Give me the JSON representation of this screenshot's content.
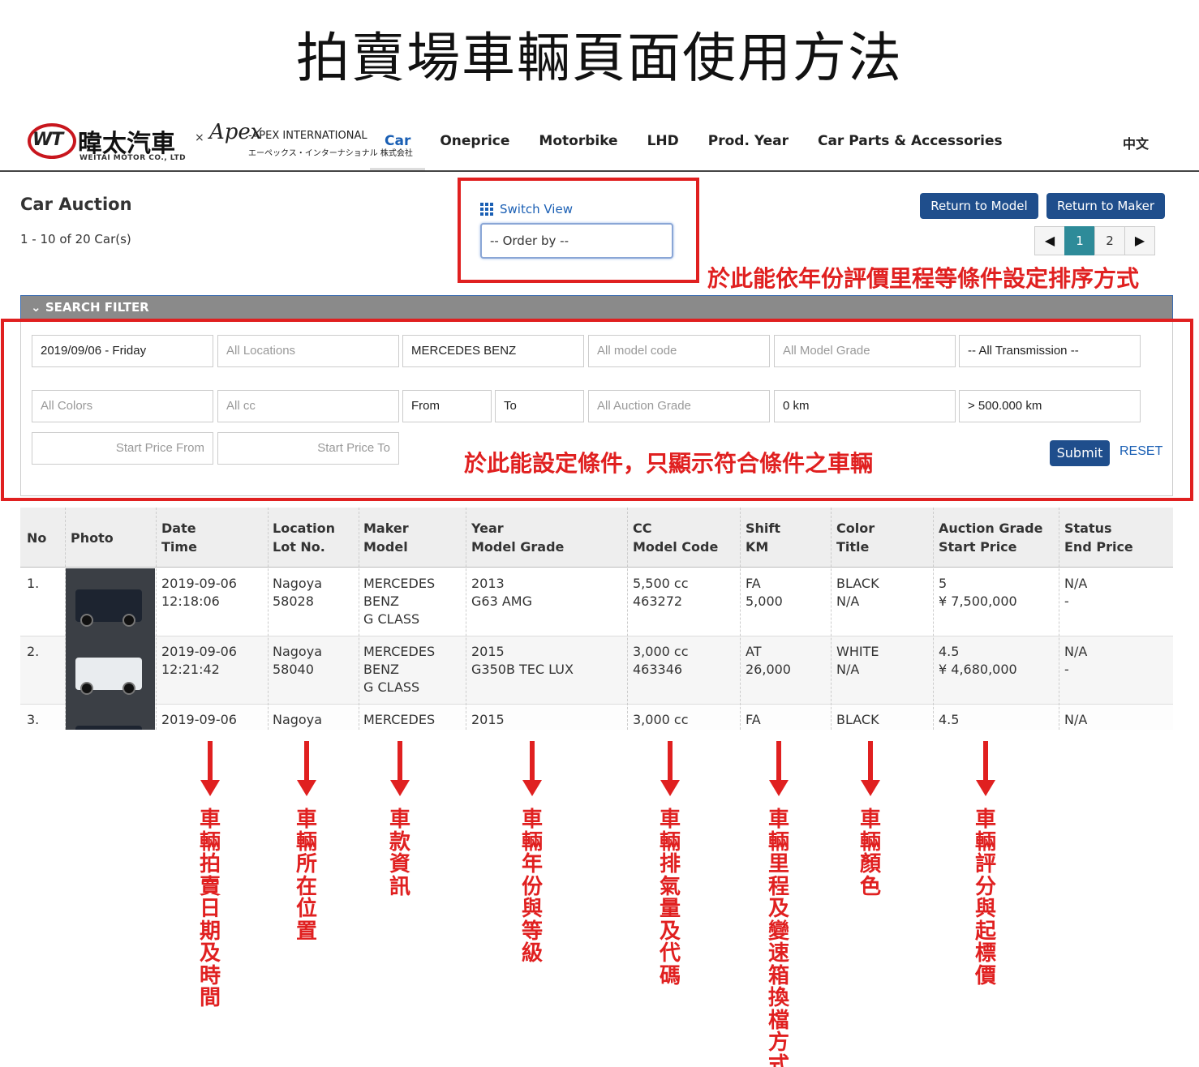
{
  "title": "拍賣場車輛頁面使用方法",
  "header": {
    "logo_wt_mark": "WT",
    "logo_wt_cn": "暐太汽車",
    "logo_wt_en": "WEITAI MOTOR CO., LTD",
    "logo_x": "×",
    "logo_apex_script": "Apex",
    "logo_apex_line1": "-APEX INTERNATIONAL",
    "logo_apex_line2": "エーペックス・インターナショナル 株式会社",
    "nav": [
      "Car",
      "Oneprice",
      "Motorbike",
      "LHD",
      "Prod. Year",
      "Car Parts & Accessories"
    ],
    "lang": "中文"
  },
  "page": {
    "heading": "Car Auction",
    "count": "1 - 10 of 20 Car(s)",
    "switch_view": "Switch View",
    "order_by": "-- Order by --",
    "return_model": "Return to Model",
    "return_maker": "Return to Maker",
    "pages": [
      "1",
      "2"
    ],
    "prev_icon": "◀",
    "next_icon": "▶"
  },
  "annotations": {
    "sort": "於此能依年份評價里程等條件設定排序方式",
    "filter": "於此能設定條件，只顯示符合條件之車輛",
    "columns": [
      "車輛拍賣日期及時間",
      "車輛所在位置",
      "車款資訊",
      "車輛年份與等級",
      "車輛排氣量及代碼",
      "車輛里程及變速箱換檔方式",
      "車輛顏色",
      "車輛評分與起標價"
    ]
  },
  "filter": {
    "header": "SEARCH FILTER",
    "date": "2019/09/06 - Friday",
    "locations": "All Locations",
    "maker": "MERCEDES BENZ",
    "model_code": "All model code",
    "model_grade": "All Model Grade",
    "transmission": "-- All Transmission --",
    "colors": "All Colors",
    "cc": "All cc",
    "from": "From",
    "to": "To",
    "auction_grade": "All Auction Grade",
    "km_from": "0 km",
    "km_to": "> 500.000 km",
    "price_from": "Start Price From",
    "price_to": "Start Price To",
    "submit": "Submit",
    "reset": "RESET"
  },
  "table": {
    "headers": [
      "No",
      "Photo",
      "Date\nTime",
      "Location\nLot No.",
      "Maker\nModel",
      "Year\nModel Grade",
      "CC\nModel Code",
      "Shift\nKM",
      "Color\nTitle",
      "Auction Grade\nStart Price",
      "Status\nEnd Price"
    ],
    "rows": [
      [
        "1.",
        "",
        "2019-09-06\n12:18:06",
        "Nagoya\n58028",
        "MERCEDES\nBENZ\nG CLASS",
        "2013\nG63 AMG",
        "5,500 cc\n463272",
        "FA\n5,000",
        "BLACK\nN/A",
        "5\n¥ 7,500,000",
        "N/A\n-"
      ],
      [
        "2.",
        "",
        "2019-09-06\n12:21:42",
        "Nagoya\n58040",
        "MERCEDES\nBENZ\nG CLASS",
        "2015\nG350B TEC LUX",
        "3,000 cc\n463346",
        "AT\n26,000",
        "WHITE\nN/A",
        "4.5\n¥ 4,680,000",
        "N/A\n-"
      ],
      [
        "3.",
        "",
        "2019-09-06",
        "Nagoya",
        "MERCEDES",
        "2015",
        "3,000 cc",
        "FA",
        "BLACK",
        "4.5",
        "N/A"
      ]
    ],
    "car_colors": [
      "#1d2430",
      "#e9ecef",
      "#1d2430"
    ]
  }
}
